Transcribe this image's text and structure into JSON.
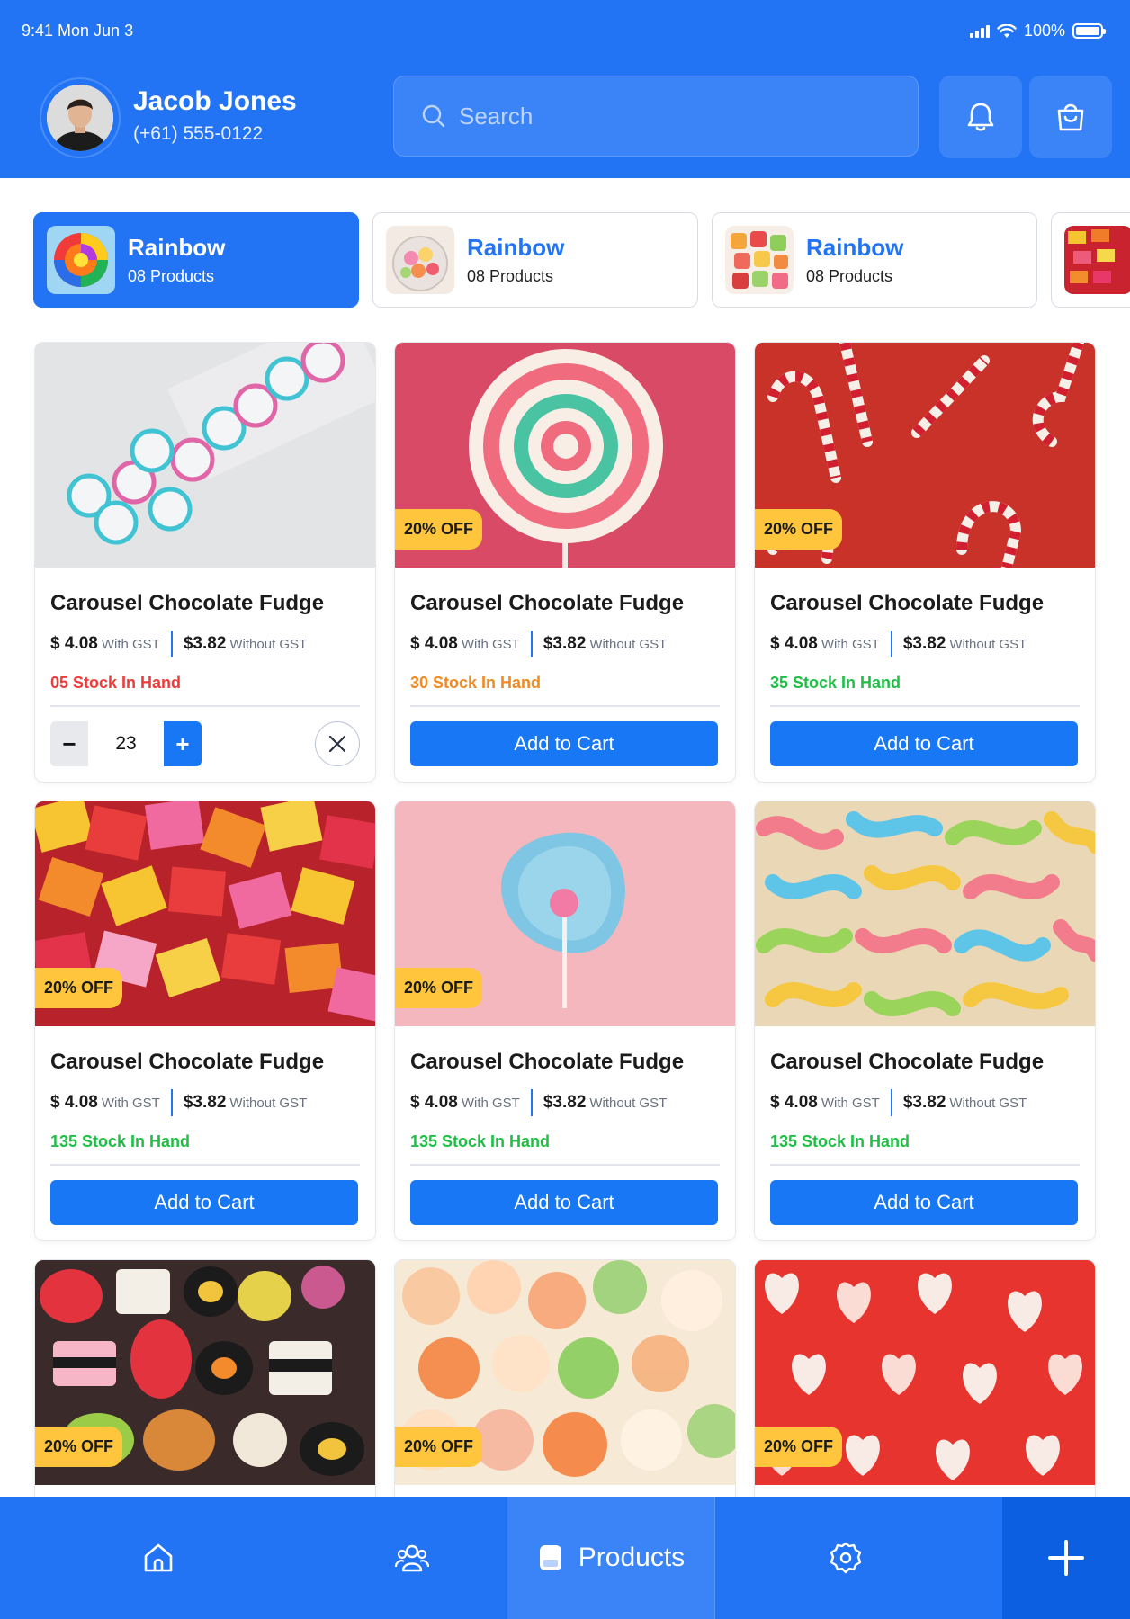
{
  "status_bar": {
    "time": "9:41  Mon Jun 3",
    "battery": "100%",
    "battery_level": 1.0
  },
  "user": {
    "name": "Jacob Jones",
    "phone": "(+61) 555-0122"
  },
  "search": {
    "placeholder": "Search"
  },
  "header_buttons": [
    {
      "icon": "bell-icon"
    },
    {
      "icon": "shopping-bag-icon"
    }
  ],
  "categories": [
    {
      "title": "Rainbow",
      "subtitle": "08 Products",
      "active": true
    },
    {
      "title": "Rainbow",
      "subtitle": "08 Products",
      "active": false
    },
    {
      "title": "Rainbow",
      "subtitle": "08 Products",
      "active": false
    }
  ],
  "products": [
    {
      "title": "Carousel Chocolate Fudge",
      "price_gst": "$ 4.08",
      "gst_label": "With GST",
      "price_nogst": "$3.82",
      "nogst_label": "Without GST",
      "stock": "05 Stock In Hand",
      "stock_color": "red",
      "discount": "",
      "in_cart": true,
      "quantity": "23",
      "action": ""
    },
    {
      "title": "Carousel Chocolate Fudge",
      "price_gst": "$ 4.08",
      "gst_label": "With GST",
      "price_nogst": "$3.82",
      "nogst_label": "Without GST",
      "stock": "30 Stock In Hand",
      "stock_color": "orange",
      "discount": "20% OFF",
      "in_cart": false,
      "action": "Add to Cart"
    },
    {
      "title": "Carousel Chocolate Fudge",
      "price_gst": "$ 4.08",
      "gst_label": "With GST",
      "price_nogst": "$3.82",
      "nogst_label": "Without GST",
      "stock": "35 Stock In Hand",
      "stock_color": "green",
      "discount": "20% OFF",
      "in_cart": false,
      "action": "Add to Cart"
    },
    {
      "title": "Carousel Chocolate Fudge",
      "price_gst": "$ 4.08",
      "gst_label": "With GST",
      "price_nogst": "$3.82",
      "nogst_label": "Without GST",
      "stock": "135 Stock In Hand",
      "stock_color": "green",
      "discount": "20% OFF",
      "in_cart": false,
      "action": "Add to Cart"
    },
    {
      "title": "Carousel Chocolate Fudge",
      "price_gst": "$ 4.08",
      "gst_label": "With GST",
      "price_nogst": "$3.82",
      "nogst_label": "Without GST",
      "stock": "135 Stock In Hand",
      "stock_color": "green",
      "discount": "20% OFF",
      "in_cart": false,
      "action": "Add to Cart"
    },
    {
      "title": "Carousel Chocolate Fudge",
      "price_gst": "$ 4.08",
      "gst_label": "With GST",
      "price_nogst": "$3.82",
      "nogst_label": "Without GST",
      "stock": "135 Stock In Hand",
      "stock_color": "green",
      "discount": "20% OFF",
      "in_cart": false,
      "action": "Add to Cart"
    },
    {
      "title": "",
      "discount": "20% OFF"
    },
    {
      "title": "",
      "discount": "20% OFF"
    },
    {
      "title": "",
      "discount": "20% OFF"
    }
  ],
  "bottom_nav": {
    "items": [
      {
        "icon": "home-icon",
        "label": ""
      },
      {
        "icon": "users-icon",
        "label": ""
      },
      {
        "icon": "products-icon",
        "label": "Products",
        "active": true
      },
      {
        "icon": "gear-icon",
        "label": ""
      }
    ],
    "add_icon": "plus-icon"
  },
  "colors": {
    "primary": "#2274f5",
    "badge": "#ffc53d",
    "stock_red": "#ef3b3b",
    "stock_orange": "#f08a24",
    "stock_green": "#1fbf46"
  }
}
